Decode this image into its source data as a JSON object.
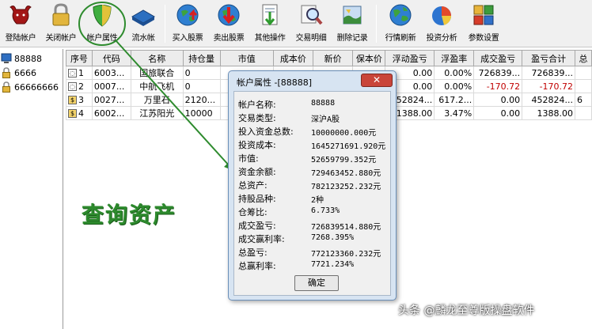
{
  "toolbar": {
    "items": [
      {
        "label": "登陆帐户",
        "icon": "bull-icon"
      },
      {
        "label": "关闭帐户",
        "icon": "padlock-icon"
      },
      {
        "label": "帐户属性",
        "icon": "shield-icon"
      },
      {
        "label": "流水帐",
        "icon": "ledger-book-icon"
      },
      {
        "label": "买入股票",
        "icon": "globe-up-arrow-icon"
      },
      {
        "label": "卖出股票",
        "icon": "globe-down-arrow-icon"
      },
      {
        "label": "其他操作",
        "icon": "document-arrow-icon"
      },
      {
        "label": "交易明细",
        "icon": "magnifier-icon"
      },
      {
        "label": "删除记录",
        "icon": "delete-record-icon"
      },
      {
        "label": "行情刷新",
        "icon": "globe-refresh-icon"
      },
      {
        "label": "投资分析",
        "icon": "pie-chart-icon"
      },
      {
        "label": "参数设置",
        "icon": "settings-blocks-icon"
      }
    ]
  },
  "tree": {
    "items": [
      {
        "label": "88888",
        "icon": "monitor-icon",
        "selected": true
      },
      {
        "label": "6666",
        "icon": "padlock-icon",
        "selected": false
      },
      {
        "label": "66666666",
        "icon": "padlock-icon",
        "selected": false
      }
    ]
  },
  "grid": {
    "columns": [
      "序号",
      "代码",
      "名称",
      "持仓量",
      "市值",
      "成本价",
      "新价",
      "保本价",
      "浮动盈亏",
      "浮盈率",
      "成交盈亏",
      "盈亏合计",
      "总"
    ],
    "rows": [
      [
        "1",
        "6003...",
        "国旅联合",
        "0",
        "",
        "",
        "",
        "",
        "0.00",
        "0.00%",
        "726839...",
        "726839...",
        ""
      ],
      [
        "2",
        "0007...",
        "中航飞机",
        "0",
        "",
        "",
        "",
        "",
        "0.00",
        "0.00%",
        "-170.72",
        "-170.72",
        ""
      ],
      [
        "3",
        "0027...",
        "万里石",
        "2120...",
        "",
        "",
        "",
        "",
        "452824...",
        "617.2...",
        "0.00",
        "452824...",
        "6"
      ],
      [
        "4",
        "6002...",
        "江苏阳光",
        "10000",
        "4",
        "",
        "",
        "",
        "1388.00",
        "3.47%",
        "0.00",
        "1388.00",
        ""
      ]
    ]
  },
  "caption": "查询资产",
  "dialog": {
    "title": "帐户属性 -[88888]",
    "close": "✕",
    "fields": [
      {
        "k": "帐户名称:",
        "v": "88888"
      },
      {
        "k": "交易类型:",
        "v": "深沪A股"
      },
      {
        "k": "投入资金总数:",
        "v": "10000000.000元"
      },
      {
        "k": "投资成本:",
        "v": "1645271691.920元"
      },
      {
        "k": "市值:",
        "v": "52659799.352元"
      },
      {
        "k": "资金余额:",
        "v": "729463452.880元"
      },
      {
        "k": "总资产:",
        "v": "782123252.232元"
      },
      {
        "k": "持股品种:",
        "v": "2种"
      },
      {
        "k": "仓筹比:",
        "v": "6.733%"
      },
      {
        "k": "成交盈亏:",
        "v": "726839514.880元"
      },
      {
        "k": "成交赢利率:",
        "v": "7268.395%"
      },
      {
        "k": "总盈亏:",
        "v": "772123360.232元"
      },
      {
        "k": "总赢利率:",
        "v": "7721.234%"
      }
    ],
    "ok": "确定"
  },
  "watermark": "头条 @麟龙至尊版操盘软件",
  "colors": {
    "accent_green": "#2d8a2d",
    "loss_red": "#c00000",
    "dialog_blue": "#d7e4f2"
  }
}
